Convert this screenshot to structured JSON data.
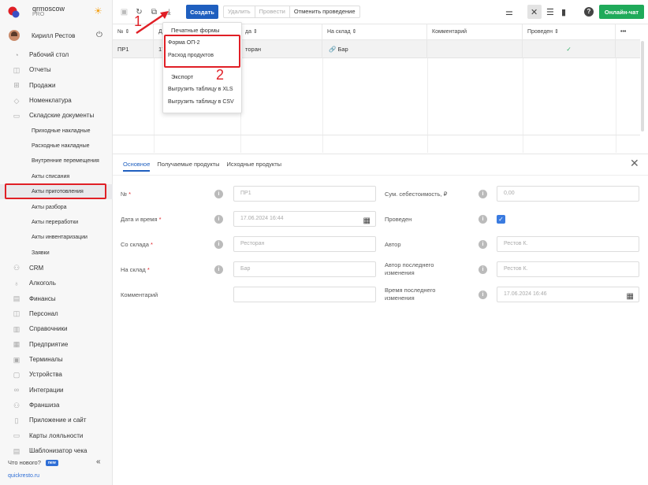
{
  "brand": {
    "name": "qrmoscow",
    "plan": "PRO"
  },
  "user": {
    "name": "Кирилл Рестов"
  },
  "nav": [
    {
      "label": "Рабочий стол",
      "icon": "dashboard-icon",
      "sub": false
    },
    {
      "label": "Отчеты",
      "icon": "reports-icon",
      "sub": false
    },
    {
      "label": "Продажи",
      "icon": "sales-icon",
      "sub": false
    },
    {
      "label": "Номенклатура",
      "icon": "tag-icon",
      "sub": false
    },
    {
      "label": "Складские документы",
      "icon": "box-icon",
      "sub": false
    },
    {
      "label": "Приходные накладные",
      "sub": true
    },
    {
      "label": "Расходные накладные",
      "sub": true
    },
    {
      "label": "Внутренние перемещения",
      "sub": true
    },
    {
      "label": "Акты списания",
      "sub": true
    },
    {
      "label": "Акты приготовления",
      "sub": true,
      "active": true
    },
    {
      "label": "Акты разбора",
      "sub": true
    },
    {
      "label": "Акты переработки",
      "sub": true
    },
    {
      "label": "Акты инвентаризации",
      "sub": true
    },
    {
      "label": "Заявки",
      "sub": true
    },
    {
      "label": "CRM",
      "icon": "crm-icon",
      "sub": false
    },
    {
      "label": "Алкоголь",
      "icon": "bottle-icon",
      "sub": false
    },
    {
      "label": "Финансы",
      "icon": "wallet-icon",
      "sub": false
    },
    {
      "label": "Персонал",
      "icon": "people-icon",
      "sub": false
    },
    {
      "label": "Справочники",
      "icon": "book-icon",
      "sub": false
    },
    {
      "label": "Предприятие",
      "icon": "building-icon",
      "sub": false
    },
    {
      "label": "Терминалы",
      "icon": "terminal-icon",
      "sub": false
    },
    {
      "label": "Устройства",
      "icon": "device-icon",
      "sub": false
    },
    {
      "label": "Интеграции",
      "icon": "link-icon",
      "sub": false
    },
    {
      "label": "Франшиза",
      "icon": "franchise-icon",
      "sub": false
    },
    {
      "label": "Приложение и сайт",
      "icon": "app-icon",
      "sub": false
    },
    {
      "label": "Карты лояльности",
      "icon": "card-icon",
      "sub": false
    },
    {
      "label": "Шаблонизатор чека",
      "icon": "receipt-icon",
      "sub": false
    }
  ],
  "footer": {
    "whats_new": "Что нового?",
    "badge": "new",
    "site": "quickresto.ru",
    "collapse": "«"
  },
  "toolbar": {
    "create": "Создать",
    "delete": "Удалить",
    "post": "Провести",
    "unpost": "Отменить проведение",
    "chat": "Онлайн-чат"
  },
  "table": {
    "columns": [
      "№ ⇕",
      "Да",
      "да ⇕",
      "На склад ⇕",
      "Комментарий",
      "Проведен ⇕",
      "•••"
    ],
    "row": {
      "num": "ПР1",
      "date": "17",
      "from": "торан",
      "to": "Бар",
      "comment": "",
      "posted": "✓"
    }
  },
  "dropdown": {
    "print_header": "Печатные формы",
    "print_items": [
      "Форма ОП-2",
      "Расход продуктов"
    ],
    "export_header": "Экспорт",
    "export_items": [
      "Выгрузить таблицу в XLS",
      "Выгрузить таблицу в CSV"
    ]
  },
  "annotations": {
    "one": "1",
    "two": "2"
  },
  "detail": {
    "tabs": [
      "Основное",
      "Получаемые продукты",
      "Исходные продукты"
    ],
    "fields": {
      "num_label": "№",
      "num_value": "ПР1",
      "date_label": "Дата и время",
      "date_value": "17.06.2024 16:44",
      "from_label": "Со склада",
      "from_value": "Ресторан",
      "to_label": "На склад",
      "to_value": "Бар",
      "comment_label": "Комментарий",
      "comment_value": "",
      "cost_label": "Сум. себестоимость, ₽",
      "cost_value": "0,00",
      "posted_label": "Проведен",
      "author_label": "Автор",
      "author_value": "Рестов К.",
      "last_author_label": "Автор последнего изменения",
      "last_author_value": "Рестов К.",
      "last_time_label": "Время последнего изменения",
      "last_time_value": "17.06.2024 16:46"
    }
  },
  "colors": {
    "accent": "#1f5fbf",
    "chat": "#1faa5a",
    "highlight": "#e01f26"
  }
}
